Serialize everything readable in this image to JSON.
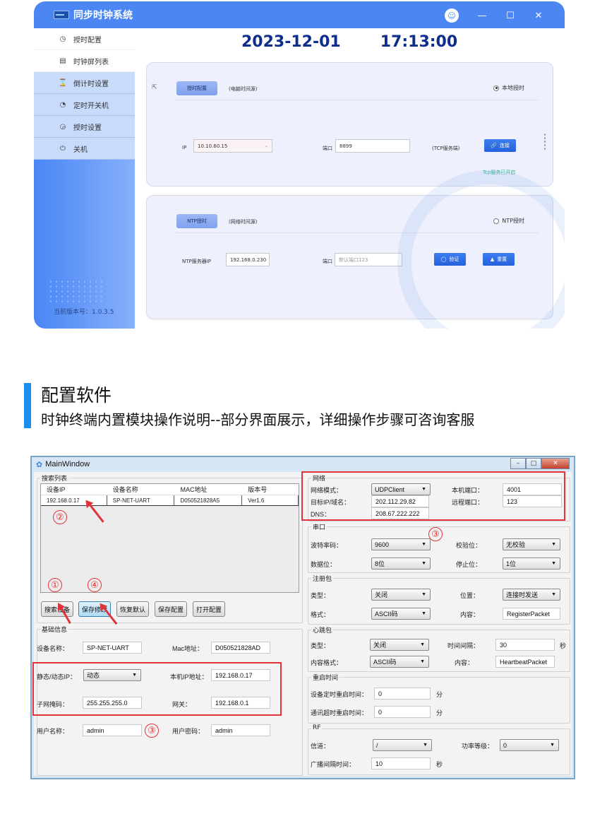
{
  "app": {
    "title": "同步时钟系统",
    "window_controls": {
      "user": "user-icon",
      "minimize": "—",
      "maximize": "☐",
      "close": "✕"
    },
    "sidebar": {
      "items": [
        {
          "icon": "clock-gear-icon",
          "glyph": "◷",
          "label": "授时配置"
        },
        {
          "icon": "list-icon",
          "glyph": "▤",
          "label": "时钟屏列表"
        },
        {
          "icon": "hourglass-icon",
          "glyph": "⌛",
          "label": "倒计时设置"
        },
        {
          "icon": "timer-icon",
          "glyph": "◔",
          "label": "定时开关机"
        },
        {
          "icon": "clock-plus-icon",
          "glyph": "◶",
          "label": "授时设置"
        },
        {
          "icon": "power-icon",
          "glyph": "⏻",
          "label": "关机"
        }
      ],
      "version": "当前版本号：1.0.3.5"
    },
    "date": "2023-12-01",
    "time": "17:13:00",
    "local_panel": {
      "tag": "授时配置",
      "note": "(电脑时间源)",
      "radio_label": "本地授时",
      "radio_selected": true,
      "ip_label": "IP",
      "ip_value": "10.10.60.15",
      "port_label": "端口",
      "port_value": "8899",
      "server_note": "(TCP服务端)",
      "connect_label": "连接",
      "status": "Tcp服务已开启"
    },
    "ntp_panel": {
      "tag": "NTP授时",
      "note": "(网络时间源)",
      "radio_label": "NTP授时",
      "radio_selected": false,
      "server_label": "NTP服务器IP",
      "server_value": "192.168.0.230",
      "port_label": "端口",
      "port_placeholder": "默认端口123",
      "verify_label": "验证",
      "reset_label": "重置"
    }
  },
  "section": {
    "title": "配置软件",
    "subtitle": "时钟终端内置模块操作说明--部分界面展示，详细操作步骤可咨询客服"
  },
  "main_window": {
    "title": "MainWindow",
    "search_group": "搜索列表",
    "columns": [
      "设备IP",
      "设备名称",
      "MAC地址",
      "版本号"
    ],
    "rows": [
      [
        "192.168.0.17",
        "SP-NET-UART",
        "D050521828A5",
        "Ver1.6"
      ]
    ],
    "buttons": [
      "搜索设备",
      "保存修改",
      "恢复默认",
      "保存配置",
      "打开配置"
    ],
    "basic": {
      "group": "基础信息",
      "device_name_label": "设备名称：",
      "device_name": "SP-NET-UART",
      "mac_label": "Mac地址：",
      "mac": "D050521828AD",
      "ip_mode_label": "静态/动态IP：",
      "ip_mode": "动态",
      "local_ip_label": "本机IP地址：",
      "local_ip": "192.168.0.17",
      "subnet_label": "子网掩码：",
      "subnet": "255.255.255.0",
      "gateway_label": "网关：",
      "gateway": "192.168.0.1",
      "user_label": "用户名称：",
      "user": "admin",
      "pwd_label": "用户密码：",
      "pwd": "admin"
    },
    "network": {
      "group": "网络",
      "mode_label": "网络模式：",
      "mode": "UDPClient",
      "local_port_label": "本机端口：",
      "local_port": "4001",
      "target_label": "目标IP/域名：",
      "target": "202.112.29.82",
      "remote_port_label": "远程端口：",
      "remote_port": "123",
      "dns_label": "DNS：",
      "dns": "208.67.222.222"
    },
    "serial": {
      "group": "串口",
      "baud_label": "波特率码：",
      "baud": "9600",
      "parity_label": "校验位：",
      "parity": "无校验",
      "data_label": "数据位：",
      "data": "8位",
      "stop_label": "停止位：",
      "stop": "1位"
    },
    "register": {
      "group": "注册包",
      "type_label": "类型：",
      "type": "关闭",
      "pos_label": "位置：",
      "pos": "连接时发送",
      "format_label": "格式：",
      "format": "ASCII码",
      "content_label": "内容：",
      "content": "RegisterPacket"
    },
    "heartbeat": {
      "group": "心跳包",
      "type_label": "类型：",
      "type": "关闭",
      "interval_label": "时间间隔：",
      "interval": "30",
      "interval_unit": "秒",
      "format_label": "内容格式：",
      "format": "ASCII码",
      "content_label": "内容：",
      "content": "HeartbeatPacket"
    },
    "restart": {
      "group": "重启时间",
      "timed_label": "设备定时重启时间：",
      "timed": "0",
      "timed_unit": "分",
      "timeout_label": "通讯超时重启时间：",
      "timeout": "0",
      "timeout_unit": "分"
    },
    "rf": {
      "group": "RF",
      "channel_label": "信道：",
      "channel": "/",
      "power_label": "功率等级：",
      "power": "0",
      "broadcast_label": "广播间隔时间：",
      "broadcast": "10",
      "broadcast_unit": "秒"
    },
    "annotations": [
      "①",
      "②",
      "③",
      "④"
    ]
  }
}
